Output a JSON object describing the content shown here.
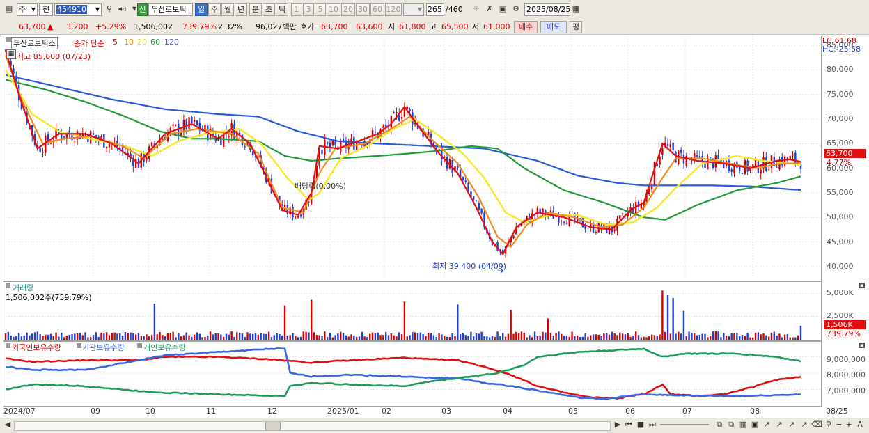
{
  "toolbar": {
    "type1": "주",
    "type2": "전",
    "code": "454910",
    "name": "두산로보틱",
    "new_badge": "신",
    "periods": [
      "일",
      "주",
      "월",
      "년",
      "분",
      "초",
      "틱"
    ],
    "selected_period": "일",
    "intervals": [
      "1",
      "3",
      "5",
      "10",
      "20",
      "30",
      "60",
      "120"
    ],
    "count": "265",
    "total": "/460",
    "date": "2025/08/25"
  },
  "quote": {
    "price": "63,700",
    "change": "3,200",
    "rate": "+5.29%",
    "volume": "1,506,002",
    "vol_ratio": "739.79%",
    "turnover": "2.32%",
    "amount": "96,027백만",
    "hoga_label": "호가",
    "ask": "63,700",
    "bid": "63,600",
    "open_label": "시",
    "open": "61,800",
    "high_label": "고",
    "high": "65,500",
    "low_label": "저",
    "low": "61,000",
    "buy": "매수",
    "sell": "매도",
    "eval": "평"
  },
  "price_panel": {
    "title": "두산로보틱스",
    "ma_label": "종가 단순",
    "ma_periods": [
      "5",
      "10",
      "20",
      "60",
      "120"
    ],
    "high_text": "최고 85,600 (07/23)",
    "low_text": "최저 39,400 (04/09)",
    "dividend_text": "배당락(0.00%)",
    "lc": "LC:61.68",
    "hc": "HC:-25.58",
    "current_tag": "63,700",
    "pct_tag": "4.77%",
    "yticks": [
      "85,000",
      "80,000",
      "75,000",
      "70,000",
      "65,000",
      "60,000",
      "55,000",
      "50,000",
      "45,000",
      "40,000"
    ]
  },
  "volume_panel": {
    "title": "거래량",
    "sub": "1,506,002주(739.79%)",
    "yticks": [
      "5,000K",
      "2,500K"
    ],
    "current_tag": "1,506K",
    "pct_tag": "739.79%"
  },
  "holding_panel": {
    "legends": [
      "외국인보유수량",
      "기관보유수량",
      "개인보유수량"
    ],
    "yticks": [
      "9,000,000",
      "8,000,000",
      "7,000,000"
    ]
  },
  "xaxis": [
    "2024/07",
    "09",
    "10",
    "11",
    "12",
    "2025/01",
    "02",
    "03",
    "04",
    "05",
    "06",
    "07",
    "08",
    "08/25"
  ],
  "colors": {
    "up": "#d40000",
    "down": "#1f3fd1",
    "ma5": "#e01010",
    "ma10": "#f08c1e",
    "ma20": "#f5e82a",
    "ma60": "#1f9a3a",
    "ma120": "#2b5ad8",
    "foreign": "#e01010",
    "inst": "#3868e0",
    "indiv": "#1f9a5a"
  },
  "chart_data": {
    "type": "candlestick",
    "price_range": [
      37000,
      87000
    ],
    "volume_range": [
      0,
      6000000
    ],
    "holding_range": [
      6200000,
      9800000
    ],
    "ma_anchors": {
      "ma5": [
        [
          0,
          84000
        ],
        [
          5,
          75000
        ],
        [
          12,
          64000
        ],
        [
          20,
          67000
        ],
        [
          30,
          67000
        ],
        [
          40,
          65000
        ],
        [
          50,
          61000
        ],
        [
          60,
          67000
        ],
        [
          70,
          69000
        ],
        [
          80,
          66000
        ],
        [
          85,
          68000
        ],
        [
          92,
          65000
        ],
        [
          100,
          56000
        ],
        [
          104,
          51500
        ],
        [
          110,
          50500
        ],
        [
          115,
          55000
        ],
        [
          118,
          64500
        ],
        [
          125,
          64000
        ],
        [
          135,
          66000
        ],
        [
          140,
          67000
        ],
        [
          145,
          69000
        ],
        [
          150,
          72500
        ],
        [
          156,
          68000
        ],
        [
          163,
          63000
        ],
        [
          170,
          59000
        ],
        [
          177,
          52000
        ],
        [
          183,
          45000
        ],
        [
          187,
          42500
        ],
        [
          192,
          48000
        ],
        [
          200,
          51000
        ],
        [
          210,
          50000
        ],
        [
          220,
          48000
        ],
        [
          228,
          47500
        ],
        [
          235,
          51500
        ],
        [
          240,
          53000
        ],
        [
          247,
          65000
        ],
        [
          252,
          62500
        ],
        [
          260,
          61500
        ],
        [
          270,
          61000
        ],
        [
          280,
          60000
        ],
        [
          290,
          61500
        ],
        [
          295,
          61800
        ],
        [
          300,
          61200
        ]
      ],
      "ma10": [
        [
          0,
          83000
        ],
        [
          6,
          74000
        ],
        [
          14,
          65000
        ],
        [
          22,
          66000
        ],
        [
          32,
          66500
        ],
        [
          44,
          64500
        ],
        [
          52,
          62000
        ],
        [
          62,
          67000
        ],
        [
          72,
          68000
        ],
        [
          85,
          67000
        ],
        [
          95,
          63000
        ],
        [
          104,
          52000
        ],
        [
          112,
          51000
        ],
        [
          118,
          59000
        ],
        [
          124,
          64000
        ],
        [
          135,
          65000
        ],
        [
          145,
          68000
        ],
        [
          152,
          70500
        ],
        [
          160,
          66000
        ],
        [
          170,
          61000
        ],
        [
          178,
          54000
        ],
        [
          185,
          46000
        ],
        [
          190,
          44000
        ],
        [
          196,
          48500
        ],
        [
          204,
          51000
        ],
        [
          214,
          50000
        ],
        [
          224,
          48000
        ],
        [
          232,
          48500
        ],
        [
          240,
          52000
        ],
        [
          247,
          58000
        ],
        [
          252,
          62000
        ],
        [
          262,
          62000
        ],
        [
          272,
          61000
        ],
        [
          282,
          60000
        ],
        [
          292,
          61000
        ],
        [
          300,
          61000
        ]
      ],
      "ma20": [
        [
          0,
          80000
        ],
        [
          10,
          71000
        ],
        [
          20,
          67500
        ],
        [
          32,
          66000
        ],
        [
          45,
          64500
        ],
        [
          55,
          62500
        ],
        [
          65,
          65500
        ],
        [
          75,
          67000
        ],
        [
          88,
          68000
        ],
        [
          96,
          65000
        ],
        [
          106,
          58000
        ],
        [
          114,
          53500
        ],
        [
          118,
          55000
        ],
        [
          126,
          62000
        ],
        [
          136,
          64500
        ],
        [
          146,
          68000
        ],
        [
          154,
          70000
        ],
        [
          162,
          67000
        ],
        [
          172,
          63000
        ],
        [
          180,
          58000
        ],
        [
          188,
          51000
        ],
        [
          195,
          49000
        ],
        [
          205,
          50500
        ],
        [
          215,
          50500
        ],
        [
          226,
          48500
        ],
        [
          236,
          49000
        ],
        [
          245,
          52000
        ],
        [
          252,
          56000
        ],
        [
          262,
          61000
        ],
        [
          275,
          62500
        ],
        [
          285,
          61500
        ],
        [
          295,
          61000
        ],
        [
          300,
          60500
        ]
      ],
      "ma60": [
        [
          0,
          78000
        ],
        [
          15,
          76000
        ],
        [
          30,
          73500
        ],
        [
          45,
          70500
        ],
        [
          58,
          67500
        ],
        [
          70,
          66000
        ],
        [
          80,
          66000
        ],
        [
          95,
          65500
        ],
        [
          105,
          62500
        ],
        [
          115,
          61500
        ],
        [
          125,
          62000
        ],
        [
          140,
          62500
        ],
        [
          152,
          63000
        ],
        [
          162,
          63500
        ],
        [
          175,
          64500
        ],
        [
          185,
          64000
        ],
        [
          195,
          60000
        ],
        [
          210,
          55500
        ],
        [
          225,
          53000
        ],
        [
          240,
          50000
        ],
        [
          248,
          49500
        ],
        [
          260,
          52500
        ],
        [
          275,
          55500
        ],
        [
          290,
          57000
        ],
        [
          300,
          58500
        ]
      ],
      "ma120": [
        [
          0,
          79000
        ],
        [
          20,
          76500
        ],
        [
          40,
          74000
        ],
        [
          60,
          72000
        ],
        [
          80,
          71000
        ],
        [
          95,
          70500
        ],
        [
          110,
          67500
        ],
        [
          125,
          65500
        ],
        [
          140,
          65000
        ],
        [
          160,
          64500
        ],
        [
          180,
          64000
        ],
        [
          200,
          61500
        ],
        [
          215,
          58500
        ],
        [
          230,
          57000
        ],
        [
          240,
          56500
        ],
        [
          250,
          56500
        ],
        [
          265,
          56500
        ],
        [
          280,
          56300
        ],
        [
          300,
          55500
        ]
      ]
    },
    "holding_anchors": {
      "foreign": [
        [
          0,
          8900000
        ],
        [
          10,
          8700000
        ],
        [
          30,
          8800000
        ],
        [
          50,
          8800000
        ],
        [
          60,
          9000000
        ],
        [
          80,
          9000000
        ],
        [
          100,
          8850000
        ],
        [
          115,
          8650000
        ],
        [
          130,
          8800000
        ],
        [
          150,
          8950000
        ],
        [
          160,
          8850000
        ],
        [
          170,
          8800000
        ],
        [
          180,
          8400000
        ],
        [
          190,
          7900000
        ],
        [
          200,
          7200000
        ],
        [
          210,
          6800000
        ],
        [
          220,
          6500000
        ],
        [
          230,
          6450000
        ],
        [
          240,
          6700000
        ],
        [
          247,
          7300000
        ],
        [
          250,
          6700000
        ],
        [
          260,
          6600000
        ],
        [
          270,
          6700000
        ],
        [
          280,
          7100000
        ],
        [
          290,
          7600000
        ],
        [
          300,
          7800000
        ]
      ],
      "inst": [
        [
          0,
          8400000
        ],
        [
          10,
          8200000
        ],
        [
          30,
          8200000
        ],
        [
          50,
          8800000
        ],
        [
          60,
          9100000
        ],
        [
          80,
          9300000
        ],
        [
          100,
          9500000
        ],
        [
          105,
          9500000
        ],
        [
          107,
          8000000
        ],
        [
          115,
          7800000
        ],
        [
          130,
          7900000
        ],
        [
          150,
          7800000
        ],
        [
          160,
          7700000
        ],
        [
          170,
          7700000
        ],
        [
          180,
          7400000
        ],
        [
          190,
          7200000
        ],
        [
          205,
          6800000
        ],
        [
          215,
          6500000
        ],
        [
          225,
          6400000
        ],
        [
          240,
          6700000
        ],
        [
          260,
          6600000
        ],
        [
          280,
          6600000
        ],
        [
          300,
          6700000
        ]
      ],
      "indiv": [
        [
          0,
          7000000
        ],
        [
          10,
          7300000
        ],
        [
          30,
          7200000
        ],
        [
          50,
          6900000
        ],
        [
          60,
          6800000
        ],
        [
          80,
          6700000
        ],
        [
          100,
          6600000
        ],
        [
          105,
          6600000
        ],
        [
          107,
          7200000
        ],
        [
          115,
          7400000
        ],
        [
          130,
          7300000
        ],
        [
          150,
          7200000
        ],
        [
          160,
          7500000
        ],
        [
          175,
          7800000
        ],
        [
          185,
          8000000
        ],
        [
          195,
          8500000
        ],
        [
          200,
          9000000
        ],
        [
          215,
          9300000
        ],
        [
          240,
          9500000
        ],
        [
          247,
          9000000
        ],
        [
          255,
          9200000
        ],
        [
          275,
          9200000
        ],
        [
          290,
          9000000
        ],
        [
          300,
          8700000
        ]
      ]
    }
  }
}
